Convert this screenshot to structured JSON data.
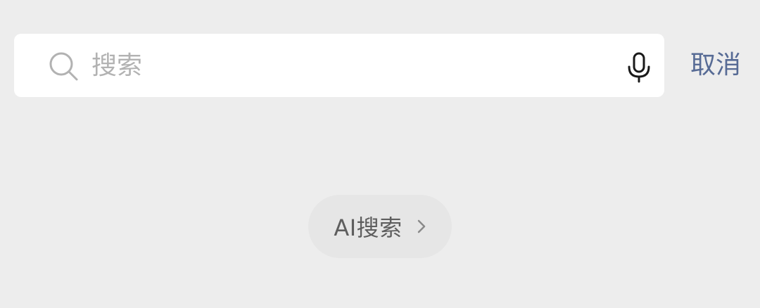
{
  "search": {
    "placeholder": "搜索",
    "value": "",
    "cancel_label": "取消"
  },
  "ai_search": {
    "label": "AI搜索"
  },
  "icons": {
    "search": "search-icon",
    "mic": "mic-icon",
    "chevron": "chevron-right-icon"
  },
  "colors": {
    "background": "#ededed",
    "accent": "#576b95",
    "placeholder": "#b2b2b2"
  }
}
